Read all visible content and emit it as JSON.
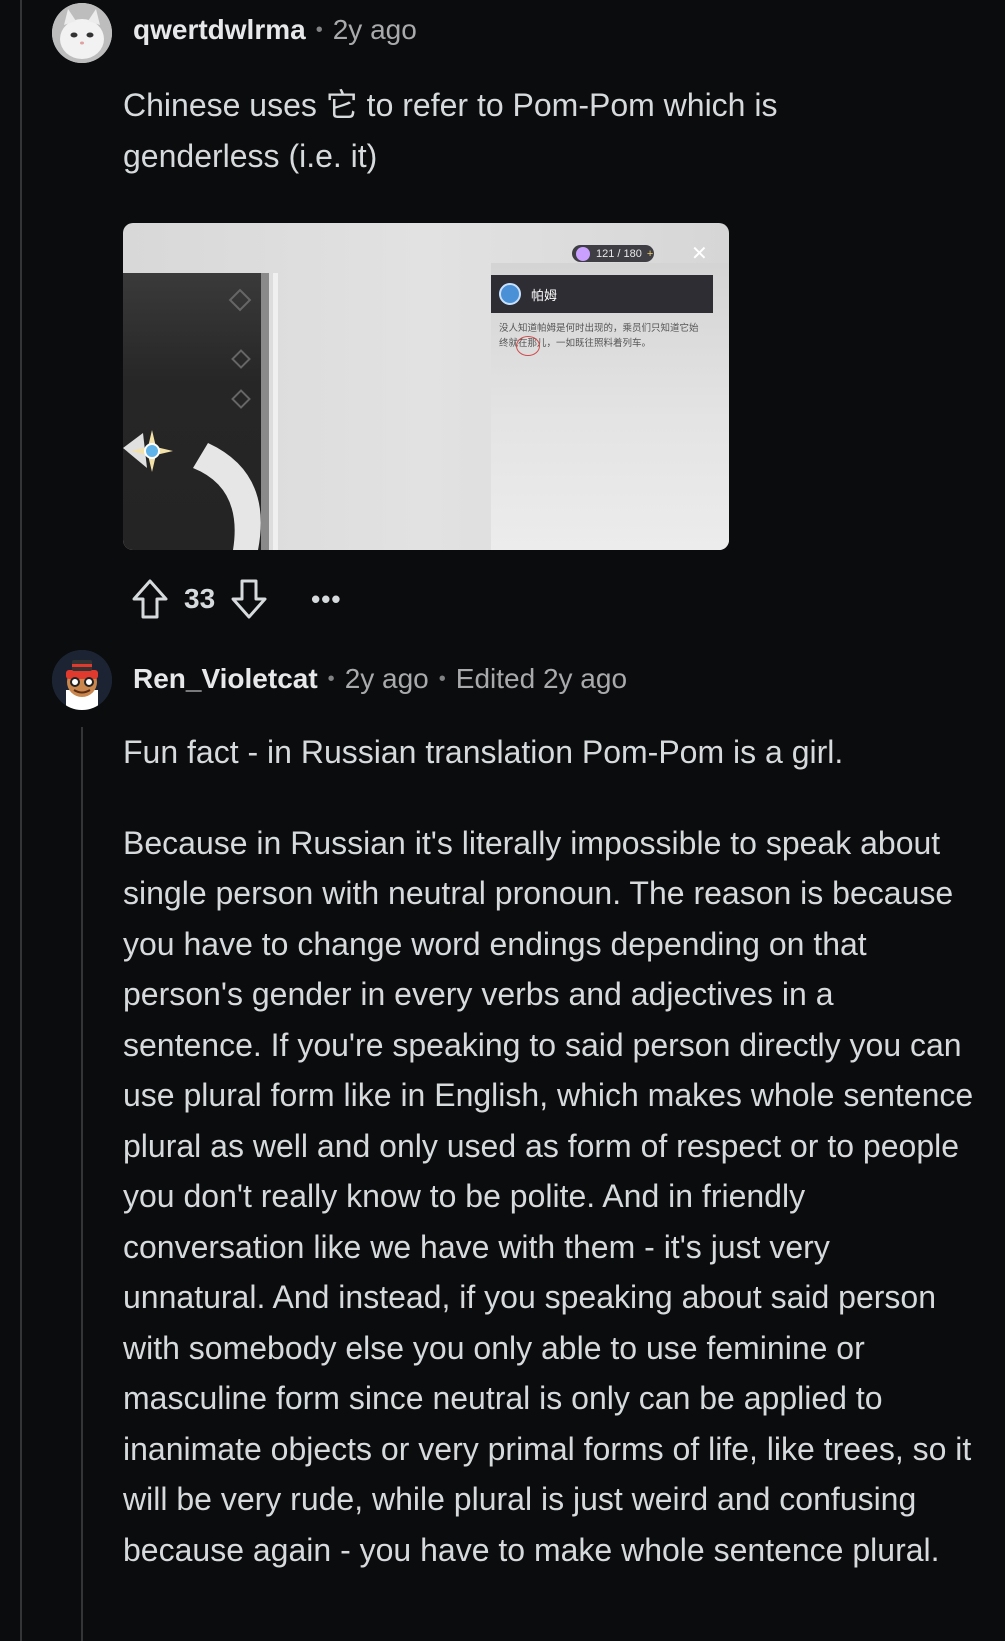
{
  "comments": [
    {
      "username": "qwertdwlrma",
      "separator": "•",
      "time": "2y ago",
      "paragraphs": [
        "Chinese uses 它 to refer to Pom-Pom which is genderless (i.e. it)"
      ],
      "image": {
        "energy": "121 / 180",
        "plus": "+",
        "close": "✕",
        "panel_title": "帕姆",
        "panel_text": "没人知道帕姆是何时出现的，乘员们只知道它始终就在那儿，一如既往照料着列车。"
      },
      "votes": "33",
      "more": "•••"
    },
    {
      "username": "Ren_Violetcat",
      "separator": "•",
      "time": "2y ago",
      "separator2": "•",
      "edited": "Edited 2y ago",
      "paragraphs": [
        "Fun fact - in Russian translation Pom-Pom is a girl.",
        "Because in Russian it's literally impossible to speak about single person with neutral pronoun. The reason is because you have to change word endings depending on that person's gender in every verbs and adjectives in a sentence. If you're speaking to said person directly you can use plural form like in English, which makes whole sentence plural as well and only used as form of respect or to people you don't really know to be polite. And in friendly conversation like we have with them - it's just very unnatural. And instead, if you speaking about said person with somebody else you only able to use feminine or masculine form since neutral is only can be applied to inanimate objects or very primal forms of life, like trees, so it will be very rude, while plural is just weird and confusing because again - you have to make whole sentence plural."
      ]
    }
  ]
}
